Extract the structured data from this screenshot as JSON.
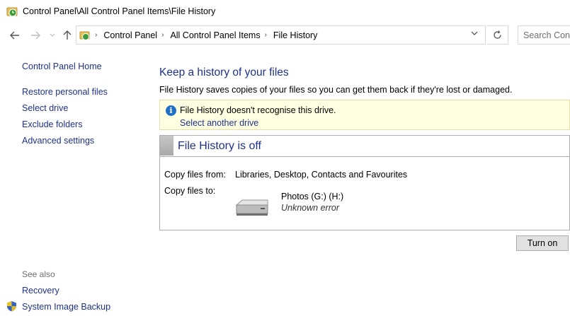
{
  "window": {
    "title": "Control Panel\\All Control Panel Items\\File History"
  },
  "nav": {
    "back_icon": "back-arrow-icon",
    "forward_icon": "forward-arrow-icon",
    "up_icon": "up-arrow-icon",
    "breadcrumbs": [
      "Control Panel",
      "All Control Panel Items",
      "File History"
    ],
    "search_placeholder": "Search Cont"
  },
  "sidebar": {
    "home_label": "Control Panel Home",
    "items": [
      "Restore personal files",
      "Select drive",
      "Exclude folders",
      "Advanced settings"
    ],
    "see_also_label": "See also",
    "see_also_items": [
      "Recovery",
      "System Image Backup"
    ]
  },
  "main": {
    "title": "Keep a history of your files",
    "description": "File History saves copies of your files so you can get them back if they're lost or damaged.",
    "infobar": {
      "message": "File History doesn't recognise this drive.",
      "action": "Select another drive"
    },
    "status": {
      "title": "File History is off",
      "copy_from_label": "Copy files from:",
      "copy_from_value": "Libraries, Desktop, Contacts and Favourites",
      "copy_to_label": "Copy files to:",
      "drive_name": "Photos (G:) (H:)",
      "drive_status": "Unknown error"
    },
    "turn_on_label": "Turn on"
  },
  "colors": {
    "link": "#1e3287",
    "info_background": "#ffffe1",
    "info_icon": "#1f6fc4"
  }
}
